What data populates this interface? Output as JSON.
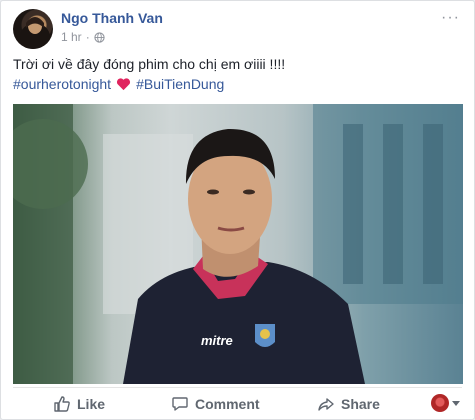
{
  "post": {
    "author": "Ngo Thanh Van",
    "time": "1 hr",
    "time_separator": "·",
    "text": "Trời ơi về đây đóng phim cho chị em ơiiii !!!!",
    "hashtags": [
      "#ourherotonight",
      "#BuiTienDung"
    ],
    "jersey_brand": "mitre",
    "privacy_icon": "globe-icon",
    "reaction_icon": "heart-icon"
  },
  "actions": {
    "like": "Like",
    "comment": "Comment",
    "share": "Share"
  },
  "colors": {
    "author_link": "#365899",
    "meta_gray": "#90949c",
    "action_gray": "#606770",
    "heart": "#e0245e",
    "jersey": "#1e2233",
    "collar": "#c8325a"
  }
}
